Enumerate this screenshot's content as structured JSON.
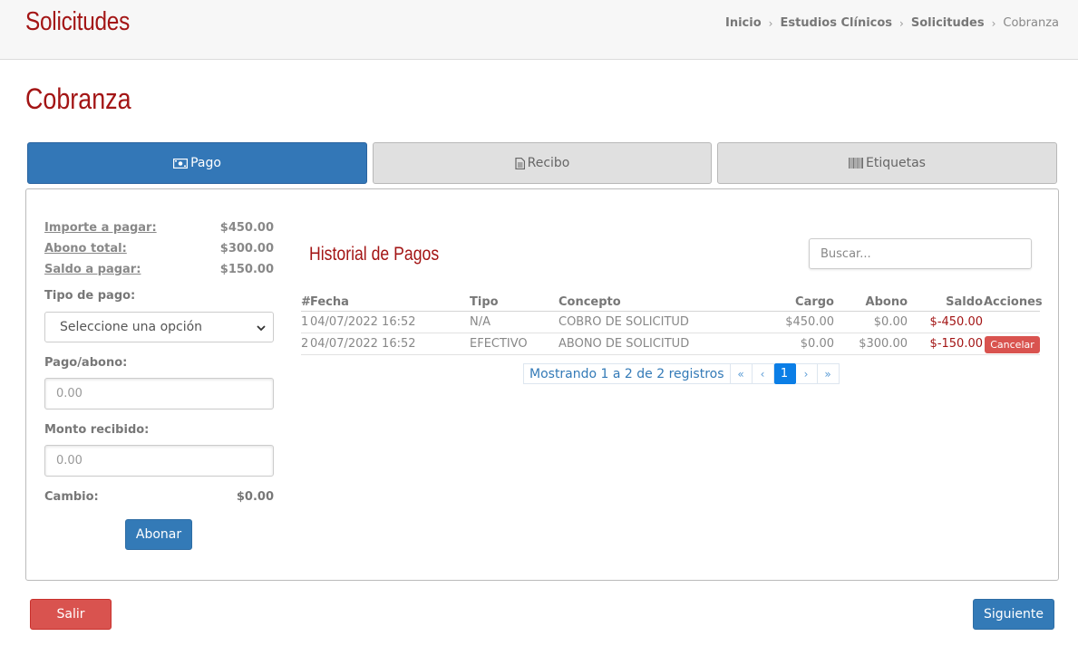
{
  "header": {
    "app_title": "Solicitudes",
    "breadcrumb": [
      {
        "label": "Inicio"
      },
      {
        "label": "Estudios Clínicos"
      },
      {
        "label": "Solicitudes"
      },
      {
        "label": "Cobranza"
      }
    ]
  },
  "page_title": "Cobranza",
  "tabs": [
    {
      "label": "Pago",
      "icon": "money-icon"
    },
    {
      "label": "Recibo",
      "icon": "file-icon"
    },
    {
      "label": "Etiquetas",
      "icon": "barcode-icon"
    }
  ],
  "summary": {
    "importe_label": "Importe a pagar:",
    "importe_value": "$450.00",
    "abono_label": "Abono total:",
    "abono_value": "$300.00",
    "saldo_label": "Saldo a pagar:",
    "saldo_value": "$150.00"
  },
  "form": {
    "tipo_pago_label": "Tipo de pago:",
    "tipo_pago_selected": "Seleccione una opción",
    "pago_label": "Pago/abono:",
    "pago_placeholder": "0.00",
    "monto_label": "Monto recibido:",
    "monto_placeholder": "0.00",
    "cambio_label": "Cambio:",
    "cambio_value": "$0.00",
    "abonar_button": "Abonar"
  },
  "history": {
    "title": "Historial de Pagos",
    "search_placeholder": "Buscar...",
    "columns": {
      "num": "#",
      "fecha": "Fecha",
      "tipo": "Tipo",
      "concepto": "Concepto",
      "cargo": "Cargo",
      "abono": "Abono",
      "saldo": "Saldo",
      "acciones": "Acciones"
    },
    "rows": [
      {
        "num": "1",
        "fecha": "04/07/2022 16:52",
        "tipo": "N/A",
        "concepto": "COBRO DE SOLICITUD",
        "cargo": "$450.00",
        "abono": "$0.00",
        "saldo": "$-450.00"
      },
      {
        "num": "2",
        "fecha": "04/07/2022 16:52",
        "tipo": "EFECTIVO",
        "concepto": "ABONO DE SOLICITUD",
        "cargo": "$0.00",
        "abono": "$300.00",
        "saldo": "$-150.00",
        "action": "Cancelar"
      }
    ],
    "pagination": {
      "info": "Mostrando 1 a 2 de 2 registros",
      "first": "«",
      "prev": "‹",
      "current": "1",
      "next": "›",
      "last": "»"
    }
  },
  "footer": {
    "salir_button": "Salir",
    "siguiente_button": "Siguiente"
  },
  "colors": {
    "brand_red": "#a31515",
    "primary": "#337ab7",
    "danger": "#d9534f"
  }
}
